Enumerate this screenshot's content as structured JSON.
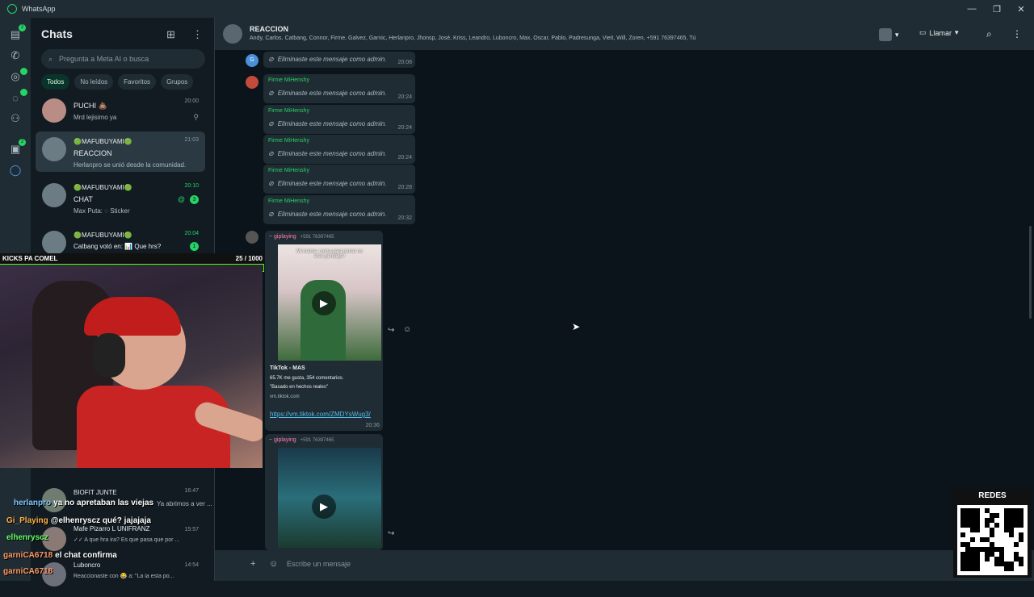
{
  "window": {
    "title": "WhatsApp"
  },
  "rail": {
    "status_badge": "2",
    "community_badge": "2"
  },
  "sidebar": {
    "title": "Chats",
    "search_placeholder": "Pregunta a Meta AI o busca",
    "filters": [
      "Todos",
      "No leídos",
      "Favoritos",
      "Grupos"
    ],
    "chats": [
      {
        "name": "PUCHI 💩",
        "preview": "Mrd lejisimo ya",
        "time": "20:00"
      },
      {
        "community": "🟢MAFUBUYAMI🟢",
        "name": "REACCION",
        "preview": "Herlanpro se unió desde la comunidad.",
        "time": "21:03"
      },
      {
        "community": "🟢MAFUBUYAMI🟢",
        "name": "CHAT",
        "preview": "Max Puta: ◌ Sticker",
        "time": "20:10",
        "badge": "3"
      },
      {
        "community": "🟢MAFUBUYAMI🟢",
        "name": "",
        "preview": "Catbang votó en: 📊 Que hrs?",
        "time": "20:04",
        "badge": "1"
      },
      {
        "name": "BIOFIT JUNTE",
        "preview": "Ya abrimos a ver ...",
        "time": "16:47"
      },
      {
        "name": "Mafe Pizarro L UNIFRANZ",
        "preview": "✓✓ A que hra ira? Es que pasa que por ...",
        "time": "15:57"
      },
      {
        "name": "Luboncro",
        "preview": "Reaccionaste con 😂 a: \"La ia esta po...",
        "time": "14:54"
      }
    ]
  },
  "overlay": {
    "kicks_label": "KICKS PA COMEL",
    "kicks_count": "25 / 1000",
    "kicks_progress": 0.025,
    "chat_lines": [
      {
        "user": "herlanpro",
        "text": "ya no apretaban las viejas",
        "color": "#7ec8ff"
      },
      {
        "user": "Gi_Playing",
        "text": "@elhenryscz qué? jajajaja",
        "color": "#ffb347"
      },
      {
        "user": "elhenryscz",
        "text": "",
        "color": "#66ff66"
      },
      {
        "user": "garniCA6718",
        "text": "el chat confirma",
        "color": "#ff9966"
      },
      {
        "user": "garniCA6718",
        "text": "",
        "color": "#ff9966"
      }
    ],
    "qr_label": "REDES"
  },
  "conversation": {
    "name": "REACCION",
    "members": "Andy, Carlos, Catbang, Connor, Firme, Galvez, Garnic, Herlanpro, Jhonsp, José, Kriss, Leandro, Luboncro, Max, Oscar, Pablo, Padresunga, Vieit, Will, Zoren, +591 76397465, Tú",
    "call_label": "Llamar",
    "messages": [
      {
        "sender": "",
        "text": "Eliminaste este mensaje como admin.",
        "time": "20:08"
      },
      {
        "sender": "Firme MiHenshy",
        "text": "Eliminaste este mensaje como admin.",
        "time": "20:24"
      },
      {
        "sender": "Firme MiHenshy",
        "text": "Eliminaste este mensaje como admin.",
        "time": "20:24"
      },
      {
        "sender": "Firme MiHenshy",
        "text": "Eliminaste este mensaje como admin.",
        "time": "20:24"
      },
      {
        "sender": "Firme MiHenshy",
        "text": "Eliminaste este mensaje como admin.",
        "time": "20:28"
      },
      {
        "sender": "Firme MiHenshy",
        "text": "Eliminaste este mensaje como admin.",
        "time": "20:32"
      }
    ],
    "media": [
      {
        "sender": "~ giplaying",
        "phone": "+591 76397465",
        "overlay_text": "Mi mama: como para tomar no eres pendejo?",
        "link_title": "TikTok - MAS",
        "link_stats": "65.7K me gusta, 354 comentarios.",
        "link_quote": "\"Basado en hechos reales\"",
        "link_domain": "vm.tiktok.com",
        "url": "https://vm.tiktok.com/ZMDYsWug3/",
        "time": "20:36"
      },
      {
        "sender": "~ giplaying",
        "phone": "+591 76397465"
      }
    ],
    "composer_placeholder": "Escribe un mensaje"
  }
}
